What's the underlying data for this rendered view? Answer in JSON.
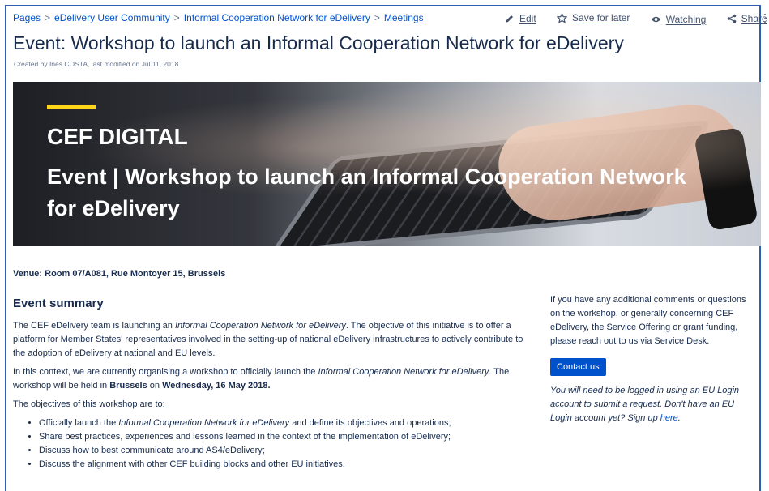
{
  "breadcrumbs": [
    "Pages",
    "eDelivery User Community",
    "Informal Cooperation Network for eDelivery",
    "Meetings"
  ],
  "actions": {
    "edit": "Edit",
    "save": "Save for later",
    "watching": "Watching",
    "share": "Share",
    "more": "⋮"
  },
  "page": {
    "title": "Event: Workshop to launch an Informal Cooperation Network for eDelivery",
    "byline": "Created by Ines COSTA, last modified on Jul 11, 2018"
  },
  "banner": {
    "line1": "CEF DIGITAL",
    "line2": "Event | Workshop to launch an Informal Cooperation Network for eDelivery"
  },
  "venue": "Venue: Room 07/A081, Rue Montoyer 15, Brussels",
  "summary": {
    "heading": "Event summary",
    "p1_a": "The CEF eDelivery team is launching an ",
    "p1_em": "Informal Cooperation Network for eDelivery",
    "p1_b": ". The objective of this initiative is to offer a platform for Member States' representatives involved in the setting-up of national eDelivery infrastructures to actively contribute to the adoption of eDelivery at national and EU levels.",
    "p2_a": "In this context, we are currently organising a workshop to officially launch the ",
    "p2_em": "Informal Cooperation Network for eDelivery",
    "p2_b": ". The workshop will be held in ",
    "p2_city": "Brussels",
    "p2_c": " on ",
    "p2_date": "Wednesday, 16 May 2018.",
    "p3": "The objectives of this workshop are to:",
    "bullet1_a": "Officially launch the ",
    "bullet1_em": "Informal Cooperation Network for eDelivery",
    "bullet1_b": " and define its objectives and operations;",
    "bullet2": "Share best practices, experiences and lessons learned in the context of the implementation of eDelivery;",
    "bullet3": "Discuss how to best communicate around AS4/eDelivery;",
    "bullet4": "Discuss the alignment with other CEF building blocks and other EU initiatives."
  },
  "sidebar": {
    "text": "If you have any additional comments or questions on the workshop, or generally concerning CEF eDelivery, the Service Offering or grant funding, please reach out to us via Service Desk.",
    "button": "Contact us",
    "note_a": "You will need to be logged in using an EU Login account to submit a request. Don't have an EU Login account yet? Sign up ",
    "note_link": "here",
    "note_b": "."
  },
  "colors": {
    "link": "#0052cc",
    "accent": "#ffd617",
    "button": "#0052cc"
  },
  "icons": [
    "pencil-icon",
    "star-icon",
    "eye-icon",
    "share-icon",
    "more-icon"
  ]
}
